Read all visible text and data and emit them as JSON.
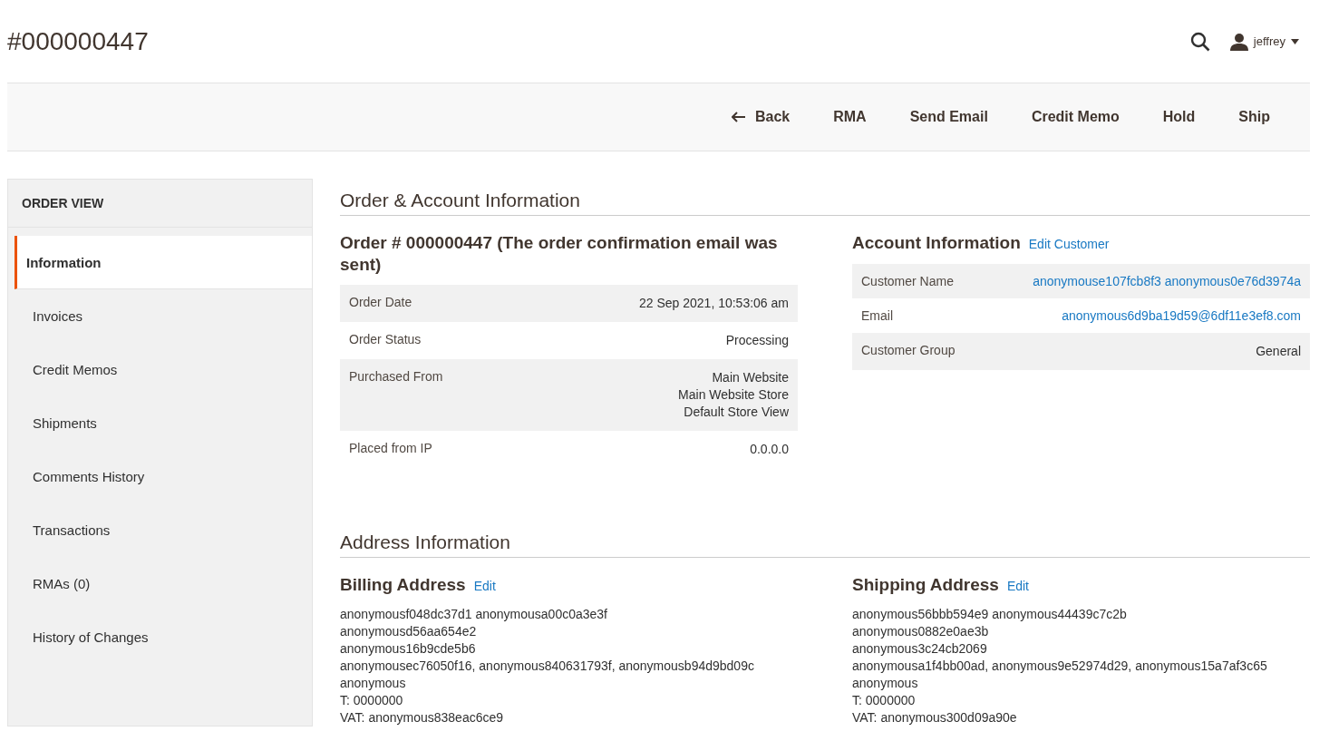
{
  "page_title": "#000000447",
  "user": {
    "name": "jeffrey"
  },
  "actions": [
    {
      "label": "Back",
      "kind": "back"
    },
    {
      "label": "RMA",
      "kind": "plain"
    },
    {
      "label": "Send Email",
      "kind": "plain"
    },
    {
      "label": "Credit Memo",
      "kind": "plain"
    },
    {
      "label": "Hold",
      "kind": "plain"
    },
    {
      "label": "Ship",
      "kind": "plain"
    }
  ],
  "sidebar": {
    "title": "ORDER VIEW",
    "items": [
      {
        "label": "Information",
        "selected": true
      },
      {
        "label": "Invoices",
        "selected": false
      },
      {
        "label": "Credit Memos",
        "selected": false
      },
      {
        "label": "Shipments",
        "selected": false
      },
      {
        "label": "Comments History",
        "selected": false
      },
      {
        "label": "Transactions",
        "selected": false
      },
      {
        "label": "RMAs (0)",
        "selected": false
      },
      {
        "label": "History of Changes",
        "selected": false
      }
    ]
  },
  "order_section": {
    "title": "Order & Account Information",
    "order": {
      "heading": "Order # 000000447 (The order confirmation email was sent)",
      "rows": [
        {
          "label": "Order Date",
          "value": [
            "22 Sep 2021, 10:53:06 am"
          ]
        },
        {
          "label": "Order Status",
          "value": [
            "Processing"
          ]
        },
        {
          "label": "Purchased From",
          "value": [
            "Main Website",
            "Main Website Store",
            "Default Store View"
          ]
        },
        {
          "label": "Placed from IP",
          "value": [
            "0.0.0.0"
          ]
        }
      ]
    },
    "account": {
      "heading": "Account Information",
      "link": "Edit Customer",
      "rows": [
        {
          "label": "Customer Name",
          "value": "anonymouse107fcb8f3 anonymous0e76d3974a",
          "kind": "link"
        },
        {
          "label": "Email",
          "value": "anonymous6d9ba19d59@6df11e3ef8.com",
          "kind": "link"
        },
        {
          "label": "Customer Group",
          "value": "General",
          "kind": "text"
        }
      ]
    }
  },
  "address_section": {
    "title": "Address Information",
    "addresses": [
      {
        "heading": "Billing Address",
        "link": "Edit",
        "lines": [
          "anonymousf048dc37d1 anonymousa00c0a3e3f",
          "anonymousd56aa654e2",
          "anonymous16b9cde5b6",
          "anonymousec76050f16, anonymous840631793f, anonymousb94d9bd09c",
          "anonymous",
          "T: 0000000",
          "VAT: anonymous838eac6ce9"
        ]
      },
      {
        "heading": "Shipping Address",
        "link": "Edit",
        "lines": [
          "anonymous56bbb594e9 anonymous44439c7c2b",
          "anonymous0882e0ae3b",
          "anonymous3c24cb2069",
          "anonymousa1f4bb00ad, anonymous9e52974d29, anonymous15a7af3c65",
          "anonymous",
          "T: 0000000",
          "VAT: anonymous300d09a90e"
        ]
      }
    ]
  }
}
